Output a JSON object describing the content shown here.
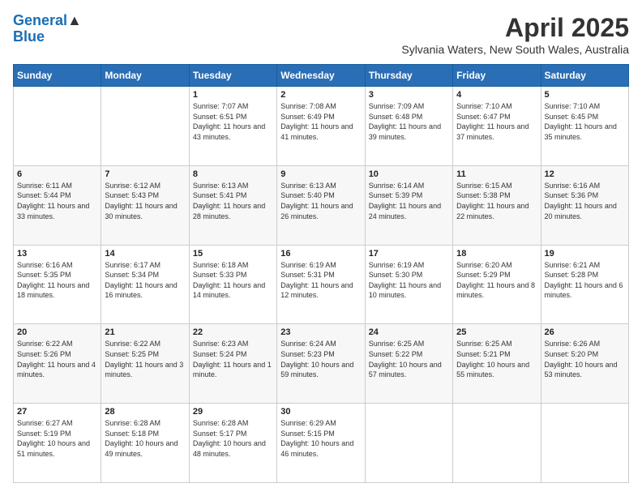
{
  "header": {
    "logo_line1": "General",
    "logo_line2": "Blue",
    "title": "April 2025",
    "subtitle": "Sylvania Waters, New South Wales, Australia"
  },
  "weekdays": [
    "Sunday",
    "Monday",
    "Tuesday",
    "Wednesday",
    "Thursday",
    "Friday",
    "Saturday"
  ],
  "weeks": [
    [
      {
        "day": "",
        "info": ""
      },
      {
        "day": "",
        "info": ""
      },
      {
        "day": "1",
        "info": "Sunrise: 7:07 AM\nSunset: 6:51 PM\nDaylight: 11 hours and 43 minutes."
      },
      {
        "day": "2",
        "info": "Sunrise: 7:08 AM\nSunset: 6:49 PM\nDaylight: 11 hours and 41 minutes."
      },
      {
        "day": "3",
        "info": "Sunrise: 7:09 AM\nSunset: 6:48 PM\nDaylight: 11 hours and 39 minutes."
      },
      {
        "day": "4",
        "info": "Sunrise: 7:10 AM\nSunset: 6:47 PM\nDaylight: 11 hours and 37 minutes."
      },
      {
        "day": "5",
        "info": "Sunrise: 7:10 AM\nSunset: 6:45 PM\nDaylight: 11 hours and 35 minutes."
      }
    ],
    [
      {
        "day": "6",
        "info": "Sunrise: 6:11 AM\nSunset: 5:44 PM\nDaylight: 11 hours and 33 minutes."
      },
      {
        "day": "7",
        "info": "Sunrise: 6:12 AM\nSunset: 5:43 PM\nDaylight: 11 hours and 30 minutes."
      },
      {
        "day": "8",
        "info": "Sunrise: 6:13 AM\nSunset: 5:41 PM\nDaylight: 11 hours and 28 minutes."
      },
      {
        "day": "9",
        "info": "Sunrise: 6:13 AM\nSunset: 5:40 PM\nDaylight: 11 hours and 26 minutes."
      },
      {
        "day": "10",
        "info": "Sunrise: 6:14 AM\nSunset: 5:39 PM\nDaylight: 11 hours and 24 minutes."
      },
      {
        "day": "11",
        "info": "Sunrise: 6:15 AM\nSunset: 5:38 PM\nDaylight: 11 hours and 22 minutes."
      },
      {
        "day": "12",
        "info": "Sunrise: 6:16 AM\nSunset: 5:36 PM\nDaylight: 11 hours and 20 minutes."
      }
    ],
    [
      {
        "day": "13",
        "info": "Sunrise: 6:16 AM\nSunset: 5:35 PM\nDaylight: 11 hours and 18 minutes."
      },
      {
        "day": "14",
        "info": "Sunrise: 6:17 AM\nSunset: 5:34 PM\nDaylight: 11 hours and 16 minutes."
      },
      {
        "day": "15",
        "info": "Sunrise: 6:18 AM\nSunset: 5:33 PM\nDaylight: 11 hours and 14 minutes."
      },
      {
        "day": "16",
        "info": "Sunrise: 6:19 AM\nSunset: 5:31 PM\nDaylight: 11 hours and 12 minutes."
      },
      {
        "day": "17",
        "info": "Sunrise: 6:19 AM\nSunset: 5:30 PM\nDaylight: 11 hours and 10 minutes."
      },
      {
        "day": "18",
        "info": "Sunrise: 6:20 AM\nSunset: 5:29 PM\nDaylight: 11 hours and 8 minutes."
      },
      {
        "day": "19",
        "info": "Sunrise: 6:21 AM\nSunset: 5:28 PM\nDaylight: 11 hours and 6 minutes."
      }
    ],
    [
      {
        "day": "20",
        "info": "Sunrise: 6:22 AM\nSunset: 5:26 PM\nDaylight: 11 hours and 4 minutes."
      },
      {
        "day": "21",
        "info": "Sunrise: 6:22 AM\nSunset: 5:25 PM\nDaylight: 11 hours and 3 minutes."
      },
      {
        "day": "22",
        "info": "Sunrise: 6:23 AM\nSunset: 5:24 PM\nDaylight: 11 hours and 1 minute."
      },
      {
        "day": "23",
        "info": "Sunrise: 6:24 AM\nSunset: 5:23 PM\nDaylight: 10 hours and 59 minutes."
      },
      {
        "day": "24",
        "info": "Sunrise: 6:25 AM\nSunset: 5:22 PM\nDaylight: 10 hours and 57 minutes."
      },
      {
        "day": "25",
        "info": "Sunrise: 6:25 AM\nSunset: 5:21 PM\nDaylight: 10 hours and 55 minutes."
      },
      {
        "day": "26",
        "info": "Sunrise: 6:26 AM\nSunset: 5:20 PM\nDaylight: 10 hours and 53 minutes."
      }
    ],
    [
      {
        "day": "27",
        "info": "Sunrise: 6:27 AM\nSunset: 5:19 PM\nDaylight: 10 hours and 51 minutes."
      },
      {
        "day": "28",
        "info": "Sunrise: 6:28 AM\nSunset: 5:18 PM\nDaylight: 10 hours and 49 minutes."
      },
      {
        "day": "29",
        "info": "Sunrise: 6:28 AM\nSunset: 5:17 PM\nDaylight: 10 hours and 48 minutes."
      },
      {
        "day": "30",
        "info": "Sunrise: 6:29 AM\nSunset: 5:15 PM\nDaylight: 10 hours and 46 minutes."
      },
      {
        "day": "",
        "info": ""
      },
      {
        "day": "",
        "info": ""
      },
      {
        "day": "",
        "info": ""
      }
    ]
  ]
}
